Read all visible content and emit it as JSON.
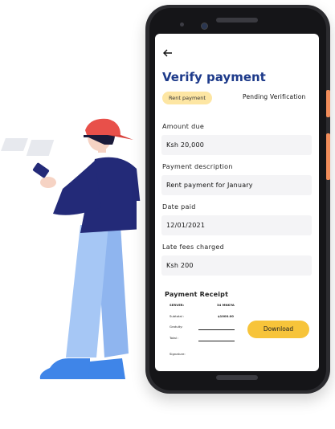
{
  "screen": {
    "back_icon": "arrow-left-icon",
    "title": "Verify payment",
    "tag": "Rent payment",
    "status": "Pending Verification",
    "fields": [
      {
        "label": "Amount due",
        "value": "Ksh 20,000"
      },
      {
        "label": "Payment description",
        "value": "Rent payment for January"
      },
      {
        "label": "Date paid",
        "value": "12/01/2021"
      },
      {
        "label": "Late fees charged",
        "value": "Ksh 200"
      }
    ],
    "receipt": {
      "title": "Payment Receipt",
      "server_label": "SERVER:",
      "server_value": "34 MNKYA",
      "subtotal_label": "Subtotal :",
      "subtotal_value": "$1000.00",
      "gratuity_label": "Gratuity:",
      "total_label": "Total :",
      "signature_label": "Signature:"
    },
    "download_label": "Download"
  },
  "colors": {
    "title": "#1d3a8a",
    "pill": "#fde6a3",
    "button": "#f7c43a",
    "cap": "#e8504a",
    "shirt": "#232a78",
    "pants": "#a6c7f5",
    "shoes": "#3f85e8"
  }
}
